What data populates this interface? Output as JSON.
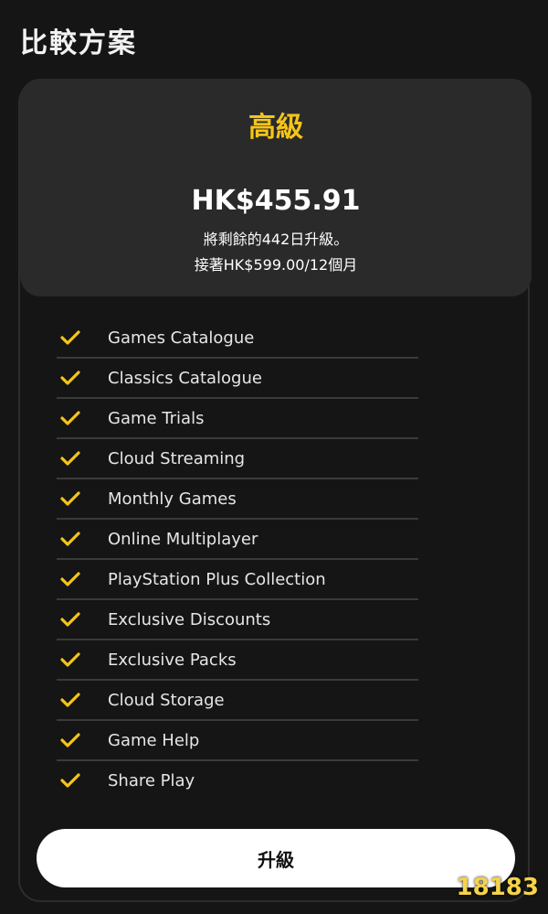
{
  "page": {
    "title": "比較方案"
  },
  "plan": {
    "name": "高級",
    "price": "HK$455.91",
    "note_line1": "將剩餘的442日升級。",
    "note_line2": "接著HK$599.00/12個月"
  },
  "features": [
    "Games Catalogue",
    "Classics Catalogue",
    "Game Trials",
    "Cloud Streaming",
    "Monthly Games",
    "Online Multiplayer",
    "PlayStation Plus Collection",
    "Exclusive Discounts",
    "Exclusive Packs",
    "Cloud Storage",
    "Game Help",
    "Share Play"
  ],
  "actions": {
    "upgrade_label": "升級"
  },
  "watermark": {
    "text": "18183"
  },
  "colors": {
    "accent": "#f5c518",
    "background": "#151515",
    "card": "#2a2a2a"
  }
}
